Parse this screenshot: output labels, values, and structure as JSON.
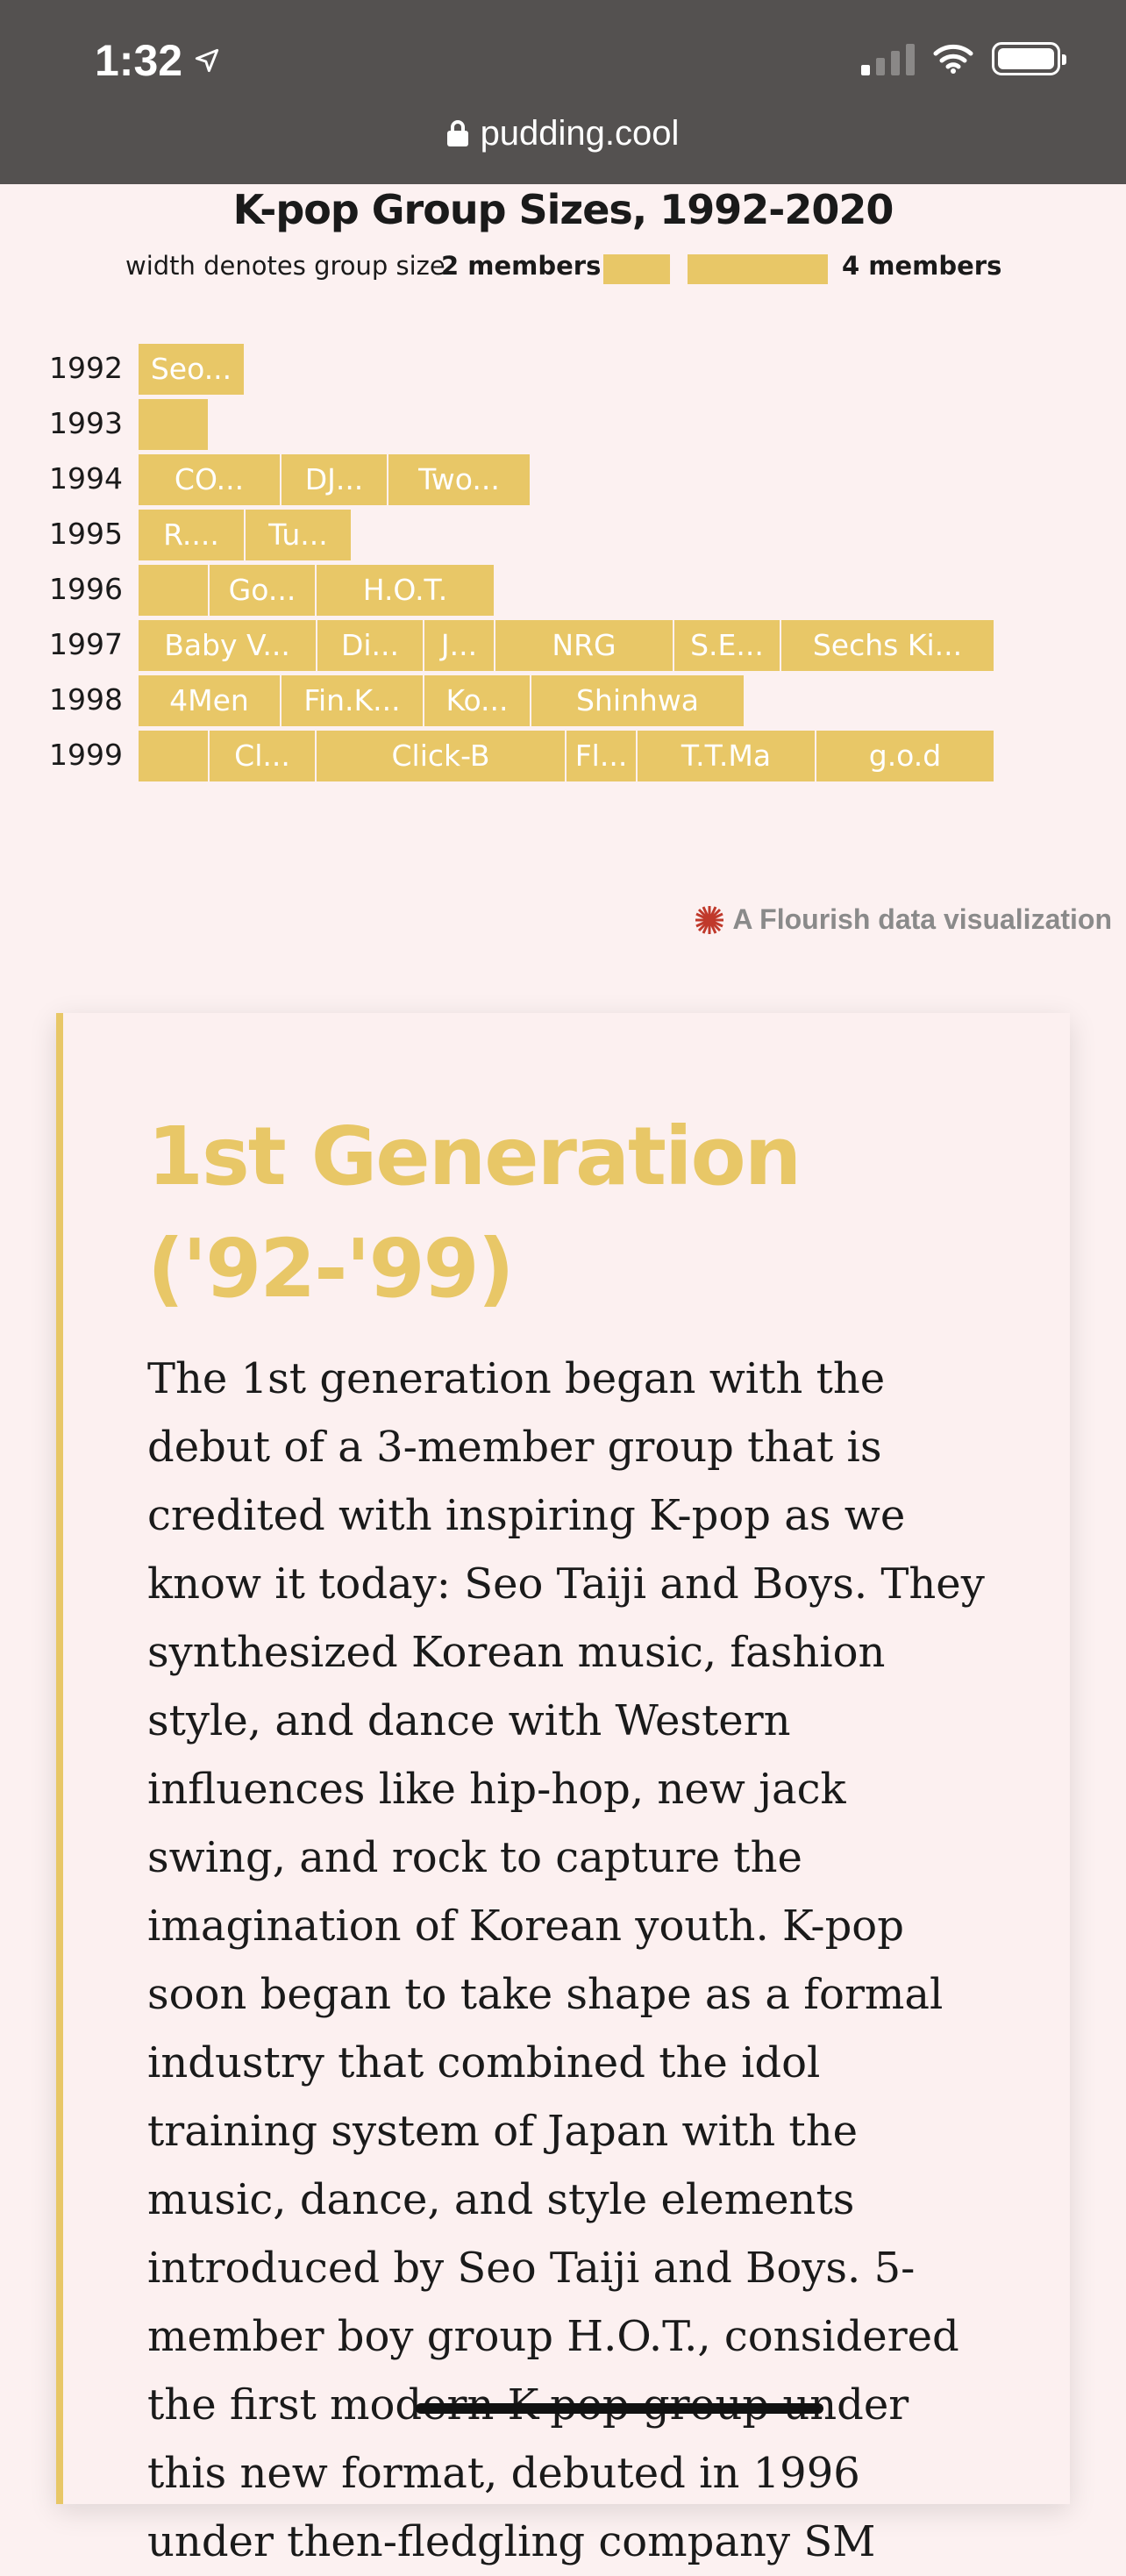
{
  "status_bar": {
    "time": "1:32"
  },
  "url_bar": {
    "domain": "pudding.cool"
  },
  "chart_data": {
    "type": "table",
    "title": "K-pop Group Sizes, 1992-2020",
    "legend": {
      "caption": "width denotes group size",
      "min_label": "2 members",
      "max_label": "4 members"
    },
    "bar_color": "#e8c767",
    "rows": [
      {
        "year": "1992",
        "groups": [
          {
            "label": "Seo...",
            "size": 3
          }
        ]
      },
      {
        "year": "1993",
        "groups": [
          {
            "label": "",
            "size": 2
          }
        ]
      },
      {
        "year": "1994",
        "groups": [
          {
            "label": "CO...",
            "size": 4
          },
          {
            "label": "DJ...",
            "size": 3
          },
          {
            "label": "Two...",
            "size": 4
          }
        ]
      },
      {
        "year": "1995",
        "groups": [
          {
            "label": "R....",
            "size": 3
          },
          {
            "label": "Tu...",
            "size": 3
          }
        ]
      },
      {
        "year": "1996",
        "groups": [
          {
            "label": "",
            "size": 2
          },
          {
            "label": "Go...",
            "size": 3
          },
          {
            "label": "H.O.T.",
            "size": 5
          }
        ]
      },
      {
        "year": "1997",
        "groups": [
          {
            "label": "Baby V...",
            "size": 5
          },
          {
            "label": "Di...",
            "size": 3
          },
          {
            "label": "J...",
            "size": 2
          },
          {
            "label": "NRG",
            "size": 5
          },
          {
            "label": "S.E...",
            "size": 3
          },
          {
            "label": "Sechs Ki...",
            "size": 6
          }
        ]
      },
      {
        "year": "1998",
        "groups": [
          {
            "label": "4Men",
            "size": 4
          },
          {
            "label": "Fin.K...",
            "size": 4
          },
          {
            "label": "Ko...",
            "size": 3
          },
          {
            "label": "Shinhwa",
            "size": 6
          }
        ]
      },
      {
        "year": "1999",
        "groups": [
          {
            "label": "",
            "size": 2
          },
          {
            "label": "Cl...",
            "size": 3
          },
          {
            "label": "Click-B",
            "size": 7
          },
          {
            "label": "Fl...",
            "size": 2
          },
          {
            "label": "T.T.Ma",
            "size": 5
          },
          {
            "label": "g.o.d",
            "size": 5
          }
        ]
      }
    ]
  },
  "credit": {
    "text": "A Flourish data visualization"
  },
  "article": {
    "heading": "1st Generation ('92-'99)",
    "body": "The 1st generation began with the debut of a 3-member group that is credited with inspiring K-pop as we know it today: Seo Taiji and Boys. They synthesized Korean music, fashion style, and dance with Western influences like hip-hop, new jack swing, and rock to capture the imagination of Korean youth. K-pop soon began to take shape as a formal industry that combined the idol training system of Japan with the music, dance, and style elements introduced by Seo Taiji and Boys. 5-member boy group H.O.T., considered the first modern K-pop group under this new format, debuted in 1996 under then-fledgling company SM"
  }
}
